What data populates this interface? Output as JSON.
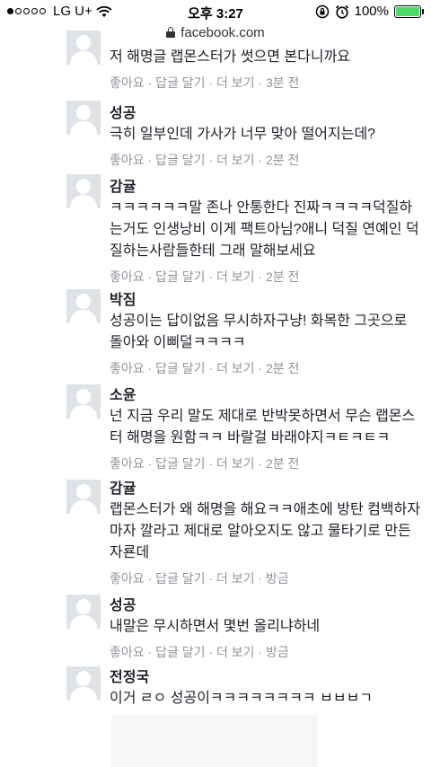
{
  "status_bar": {
    "carrier": "LG U+",
    "time": "오후 3:27",
    "battery": "100%",
    "battery_level": 1.0,
    "signal_filled": 1,
    "signal_total": 5,
    "icons": [
      "wifi-icon",
      "rotation-lock-icon",
      "alarm-icon",
      "battery-icon"
    ]
  },
  "url_bar": {
    "domain": "facebook.com",
    "icon": "lock-icon"
  },
  "actions": {
    "like": "좋아요",
    "reply": "답글 달기",
    "more": "더 보기",
    "sep": " · "
  },
  "comments": [
    {
      "name": "",
      "text": "저 해명글 랩몬스터가 썻으면 본다니까요",
      "time": "3분 전"
    },
    {
      "name": "성공",
      "text": "극히 일부인데 가사가 너무 맞아 떨어지는데?",
      "time": "2분 전"
    },
    {
      "name": "감귤",
      "text": "ㅋㅋㅋㅋㅋㅋ말 존나 안통한다 진짜ㅋㅋㅋㅋ덕질하는거도 인생낭비 이게 팩트아님?애니 덕질 연예인 덕질하는사람들한테 그래 말해보세요",
      "time": "2분 전"
    },
    {
      "name": "박짐",
      "text": "성공이는 답이없음 무시하자구냥! 화목한 그곳으로 돌아와 이삐덜ㅋㅋㅋㅋ",
      "time": "2분 전"
    },
    {
      "name": "소윤",
      "text": "넌 지금 우리 말도 제대로 반박못하면서 무슨 랩몬스터 해명을 원함ㅋㅋ 바랄걸 바래야지ㅋㅌㅋㅌㅋ",
      "time": "2분 전"
    },
    {
      "name": "감귤",
      "text": "랩몬스터가 왜 해명을 해요ㅋㅋ애초에 방탄 컴백하자마자 깔라고 제대로 알아오지도 않고 물타기로 만든 자룐데",
      "time": "방금"
    },
    {
      "name": "성공",
      "text": "내말은 무시하면서 몇번 올리냐하네",
      "time": "방금"
    },
    {
      "name": "전정국",
      "text": "이거 ㄹㅇ 성공이ㅋㅋㅋㅋㅋㅋㅋㅋ ㅂㅂㅂㄱ",
      "time": ""
    }
  ]
}
